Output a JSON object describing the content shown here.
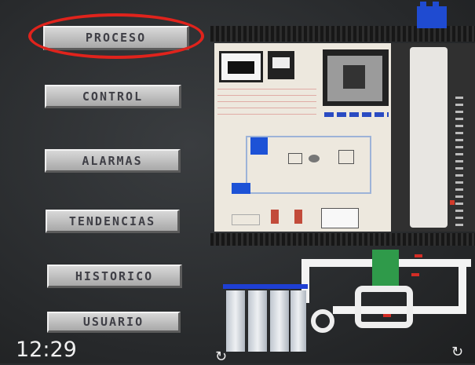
{
  "menu": {
    "items": [
      {
        "label": "PROCESO"
      },
      {
        "label": "CONTROL"
      },
      {
        "label": "ALARMAS"
      },
      {
        "label": "TENDENCIAS"
      },
      {
        "label": "HISTORICO"
      },
      {
        "label": "USUARIO"
      }
    ],
    "selected": "PROCESO"
  },
  "status": {
    "clock": "12:29"
  },
  "colors": {
    "highlight": "#e0231c",
    "tank": "#1f4bd1",
    "valve": "#2f9a4a",
    "button": "#bdbdbd"
  },
  "icons": {
    "bottom_left": "refresh-icon",
    "bottom_right": "refresh-icon"
  }
}
